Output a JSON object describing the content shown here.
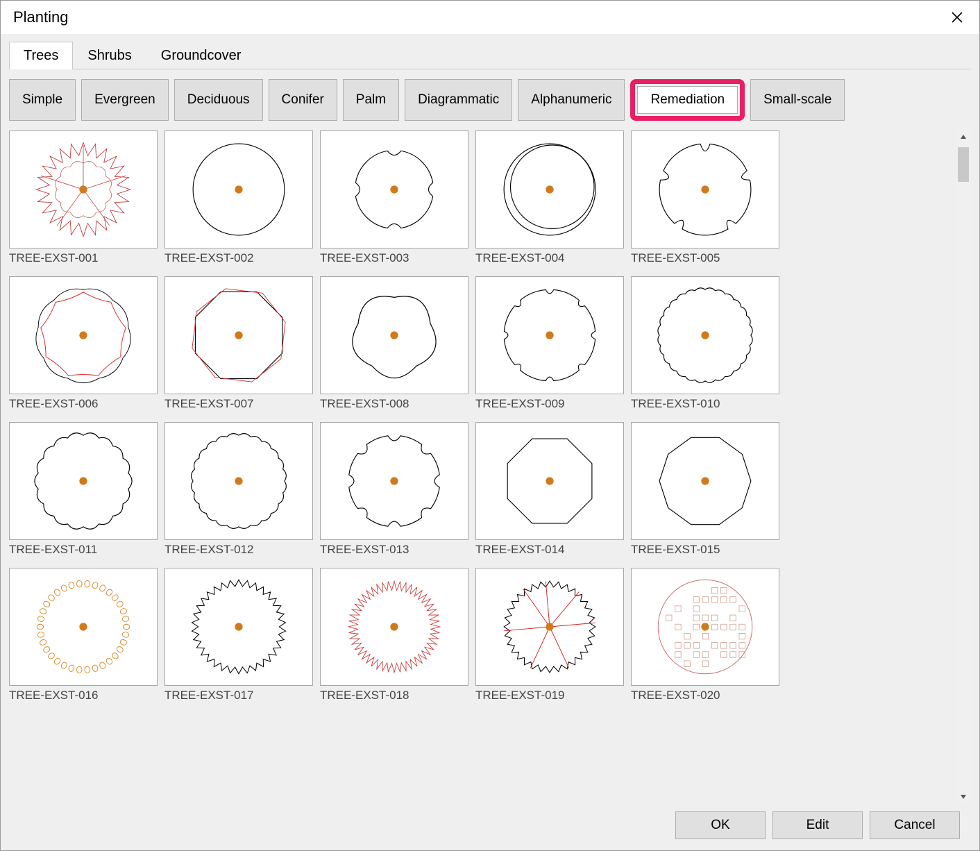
{
  "dialog": {
    "title": "Planting"
  },
  "primaryTabs": [
    {
      "label": "Trees",
      "active": true
    },
    {
      "label": "Shrubs",
      "active": false
    },
    {
      "label": "Groundcover",
      "active": false
    }
  ],
  "filters": [
    {
      "label": "Simple"
    },
    {
      "label": "Evergreen"
    },
    {
      "label": "Deciduous"
    },
    {
      "label": "Conifer"
    },
    {
      "label": "Palm"
    },
    {
      "label": "Diagrammatic"
    },
    {
      "label": "Alphanumeric"
    },
    {
      "label": "Remediation",
      "highlighted": true,
      "selected": true
    },
    {
      "label": "Small-scale"
    }
  ],
  "symbols": [
    {
      "label": "TREE-EXST-001",
      "variant": "leafy-red"
    },
    {
      "label": "TREE-EXST-002",
      "variant": "circle"
    },
    {
      "label": "TREE-EXST-003",
      "variant": "circle-4notch"
    },
    {
      "label": "TREE-EXST-004",
      "variant": "double-circle-offset"
    },
    {
      "label": "TREE-EXST-005",
      "variant": "circle-wedge5"
    },
    {
      "label": "TREE-EXST-006",
      "variant": "wavy-red"
    },
    {
      "label": "TREE-EXST-007",
      "variant": "octagon-red"
    },
    {
      "label": "TREE-EXST-008",
      "variant": "cloud5"
    },
    {
      "label": "TREE-EXST-009",
      "variant": "circle-8notch"
    },
    {
      "label": "TREE-EXST-010",
      "variant": "scallop-dense"
    },
    {
      "label": "TREE-EXST-011",
      "variant": "scallop-notch"
    },
    {
      "label": "TREE-EXST-012",
      "variant": "scallop-medium"
    },
    {
      "label": "TREE-EXST-013",
      "variant": "cloud8-inner"
    },
    {
      "label": "TREE-EXST-014",
      "variant": "octagon-inner"
    },
    {
      "label": "TREE-EXST-015",
      "variant": "decagon-bump"
    },
    {
      "label": "TREE-EXST-016",
      "variant": "dotted-ring-orange"
    },
    {
      "label": "TREE-EXST-017",
      "variant": "spiky"
    },
    {
      "label": "TREE-EXST-018",
      "variant": "burst-red"
    },
    {
      "label": "TREE-EXST-019",
      "variant": "spiky-rays-red"
    },
    {
      "label": "TREE-EXST-020",
      "variant": "pattern-red"
    }
  ],
  "footer": {
    "ok": "OK",
    "edit": "Edit",
    "cancel": "Cancel"
  }
}
